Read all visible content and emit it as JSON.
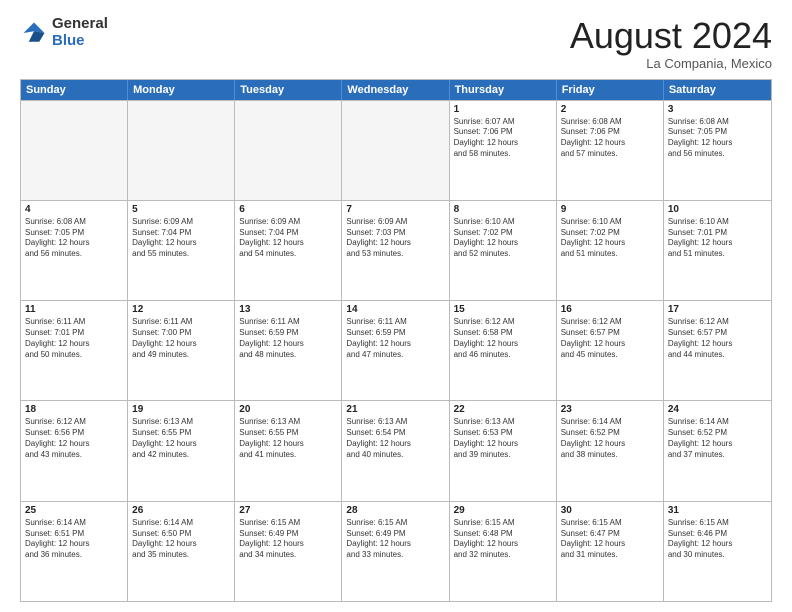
{
  "logo": {
    "general": "General",
    "blue": "Blue"
  },
  "title": "August 2024",
  "subtitle": "La Compania, Mexico",
  "days": [
    "Sunday",
    "Monday",
    "Tuesday",
    "Wednesday",
    "Thursday",
    "Friday",
    "Saturday"
  ],
  "weeks": [
    [
      {
        "day": "",
        "empty": true
      },
      {
        "day": "",
        "empty": true
      },
      {
        "day": "",
        "empty": true
      },
      {
        "day": "",
        "empty": true
      },
      {
        "day": "1",
        "lines": [
          "Sunrise: 6:07 AM",
          "Sunset: 7:06 PM",
          "Daylight: 12 hours",
          "and 58 minutes."
        ]
      },
      {
        "day": "2",
        "lines": [
          "Sunrise: 6:08 AM",
          "Sunset: 7:06 PM",
          "Daylight: 12 hours",
          "and 57 minutes."
        ]
      },
      {
        "day": "3",
        "lines": [
          "Sunrise: 6:08 AM",
          "Sunset: 7:05 PM",
          "Daylight: 12 hours",
          "and 56 minutes."
        ]
      }
    ],
    [
      {
        "day": "4",
        "lines": [
          "Sunrise: 6:08 AM",
          "Sunset: 7:05 PM",
          "Daylight: 12 hours",
          "and 56 minutes."
        ]
      },
      {
        "day": "5",
        "lines": [
          "Sunrise: 6:09 AM",
          "Sunset: 7:04 PM",
          "Daylight: 12 hours",
          "and 55 minutes."
        ]
      },
      {
        "day": "6",
        "lines": [
          "Sunrise: 6:09 AM",
          "Sunset: 7:04 PM",
          "Daylight: 12 hours",
          "and 54 minutes."
        ]
      },
      {
        "day": "7",
        "lines": [
          "Sunrise: 6:09 AM",
          "Sunset: 7:03 PM",
          "Daylight: 12 hours",
          "and 53 minutes."
        ]
      },
      {
        "day": "8",
        "lines": [
          "Sunrise: 6:10 AM",
          "Sunset: 7:02 PM",
          "Daylight: 12 hours",
          "and 52 minutes."
        ]
      },
      {
        "day": "9",
        "lines": [
          "Sunrise: 6:10 AM",
          "Sunset: 7:02 PM",
          "Daylight: 12 hours",
          "and 51 minutes."
        ]
      },
      {
        "day": "10",
        "lines": [
          "Sunrise: 6:10 AM",
          "Sunset: 7:01 PM",
          "Daylight: 12 hours",
          "and 51 minutes."
        ]
      }
    ],
    [
      {
        "day": "11",
        "lines": [
          "Sunrise: 6:11 AM",
          "Sunset: 7:01 PM",
          "Daylight: 12 hours",
          "and 50 minutes."
        ]
      },
      {
        "day": "12",
        "lines": [
          "Sunrise: 6:11 AM",
          "Sunset: 7:00 PM",
          "Daylight: 12 hours",
          "and 49 minutes."
        ]
      },
      {
        "day": "13",
        "lines": [
          "Sunrise: 6:11 AM",
          "Sunset: 6:59 PM",
          "Daylight: 12 hours",
          "and 48 minutes."
        ]
      },
      {
        "day": "14",
        "lines": [
          "Sunrise: 6:11 AM",
          "Sunset: 6:59 PM",
          "Daylight: 12 hours",
          "and 47 minutes."
        ]
      },
      {
        "day": "15",
        "lines": [
          "Sunrise: 6:12 AM",
          "Sunset: 6:58 PM",
          "Daylight: 12 hours",
          "and 46 minutes."
        ]
      },
      {
        "day": "16",
        "lines": [
          "Sunrise: 6:12 AM",
          "Sunset: 6:57 PM",
          "Daylight: 12 hours",
          "and 45 minutes."
        ]
      },
      {
        "day": "17",
        "lines": [
          "Sunrise: 6:12 AM",
          "Sunset: 6:57 PM",
          "Daylight: 12 hours",
          "and 44 minutes."
        ]
      }
    ],
    [
      {
        "day": "18",
        "lines": [
          "Sunrise: 6:12 AM",
          "Sunset: 6:56 PM",
          "Daylight: 12 hours",
          "and 43 minutes."
        ]
      },
      {
        "day": "19",
        "lines": [
          "Sunrise: 6:13 AM",
          "Sunset: 6:55 PM",
          "Daylight: 12 hours",
          "and 42 minutes."
        ]
      },
      {
        "day": "20",
        "lines": [
          "Sunrise: 6:13 AM",
          "Sunset: 6:55 PM",
          "Daylight: 12 hours",
          "and 41 minutes."
        ]
      },
      {
        "day": "21",
        "lines": [
          "Sunrise: 6:13 AM",
          "Sunset: 6:54 PM",
          "Daylight: 12 hours",
          "and 40 minutes."
        ]
      },
      {
        "day": "22",
        "lines": [
          "Sunrise: 6:13 AM",
          "Sunset: 6:53 PM",
          "Daylight: 12 hours",
          "and 39 minutes."
        ]
      },
      {
        "day": "23",
        "lines": [
          "Sunrise: 6:14 AM",
          "Sunset: 6:52 PM",
          "Daylight: 12 hours",
          "and 38 minutes."
        ]
      },
      {
        "day": "24",
        "lines": [
          "Sunrise: 6:14 AM",
          "Sunset: 6:52 PM",
          "Daylight: 12 hours",
          "and 37 minutes."
        ]
      }
    ],
    [
      {
        "day": "25",
        "lines": [
          "Sunrise: 6:14 AM",
          "Sunset: 6:51 PM",
          "Daylight: 12 hours",
          "and 36 minutes."
        ]
      },
      {
        "day": "26",
        "lines": [
          "Sunrise: 6:14 AM",
          "Sunset: 6:50 PM",
          "Daylight: 12 hours",
          "and 35 minutes."
        ]
      },
      {
        "day": "27",
        "lines": [
          "Sunrise: 6:15 AM",
          "Sunset: 6:49 PM",
          "Daylight: 12 hours",
          "and 34 minutes."
        ]
      },
      {
        "day": "28",
        "lines": [
          "Sunrise: 6:15 AM",
          "Sunset: 6:49 PM",
          "Daylight: 12 hours",
          "and 33 minutes."
        ]
      },
      {
        "day": "29",
        "lines": [
          "Sunrise: 6:15 AM",
          "Sunset: 6:48 PM",
          "Daylight: 12 hours",
          "and 32 minutes."
        ]
      },
      {
        "day": "30",
        "lines": [
          "Sunrise: 6:15 AM",
          "Sunset: 6:47 PM",
          "Daylight: 12 hours",
          "and 31 minutes."
        ]
      },
      {
        "day": "31",
        "lines": [
          "Sunrise: 6:15 AM",
          "Sunset: 6:46 PM",
          "Daylight: 12 hours",
          "and 30 minutes."
        ]
      }
    ]
  ]
}
